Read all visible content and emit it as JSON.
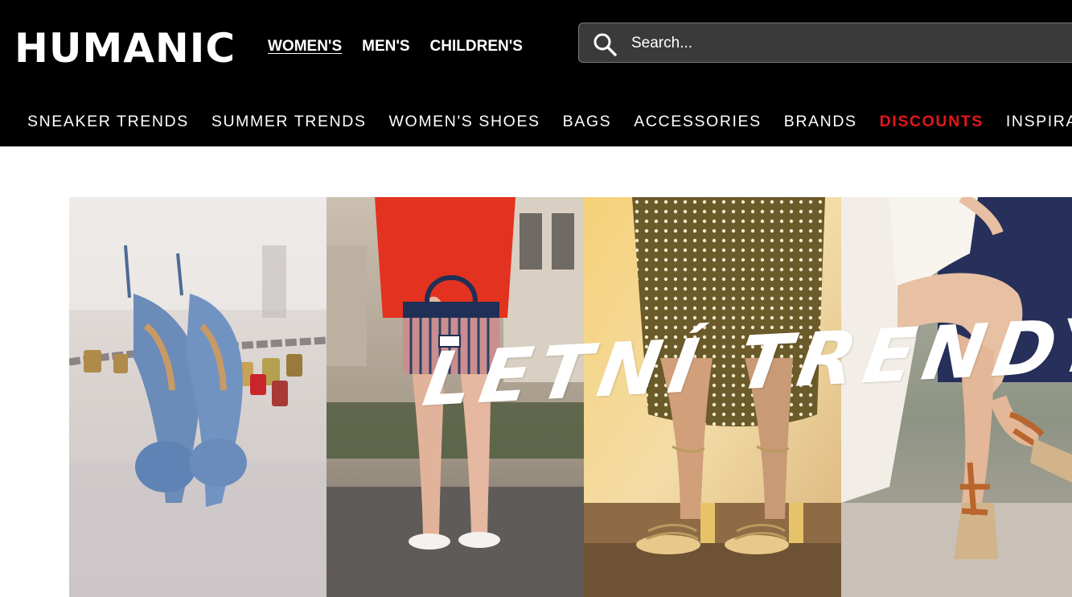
{
  "brand": {
    "logo_text": "HUMANIC"
  },
  "gender_nav": [
    {
      "label": "WOMEN'S",
      "active": true
    },
    {
      "label": "MEN'S",
      "active": false
    },
    {
      "label": "CHILDREN'S",
      "active": false
    }
  ],
  "search": {
    "placeholder": "Search...",
    "value": "",
    "icon": "search-icon"
  },
  "category_nav": [
    {
      "label": "SNEAKER TRENDS"
    },
    {
      "label": "SUMMER TRENDS"
    },
    {
      "label": "WOMEN'S SHOES"
    },
    {
      "label": "BAGS"
    },
    {
      "label": "ACCESSORIES"
    },
    {
      "label": "BRANDS"
    },
    {
      "label": "DISCOUNTS",
      "highlight": true
    },
    {
      "label": "INSPIRATION"
    }
  ],
  "banner": {
    "title": "LETNÍ TRENDY"
  },
  "colors": {
    "header_bg": "#000000",
    "header_text": "#ffffff",
    "discount_red": "#e4161b",
    "search_bg": "#3a3a3a",
    "page_bg": "#ffffff"
  }
}
